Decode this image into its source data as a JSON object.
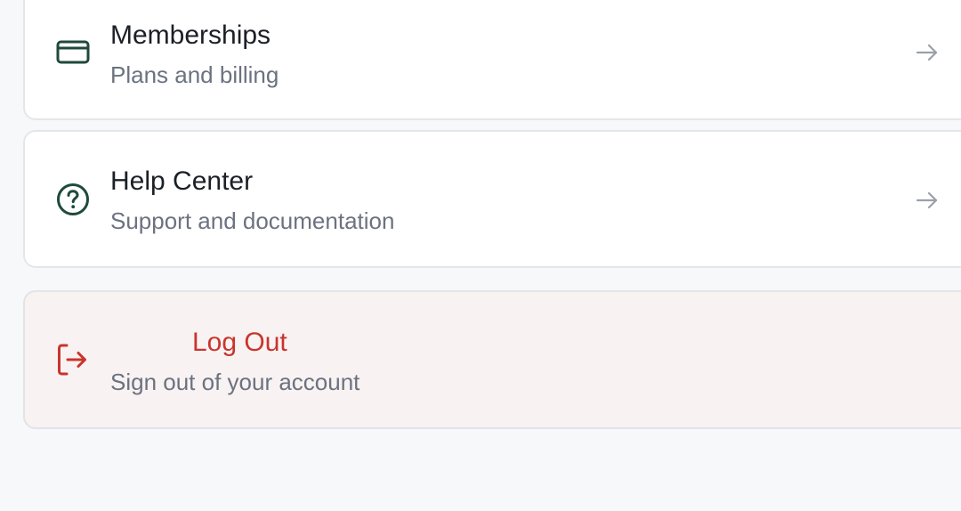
{
  "menu": {
    "memberships": {
      "icon": "credit-card-icon",
      "title": "Memberships",
      "subtitle": "Plans and billing",
      "arrow_icon": "arrow-right-icon"
    },
    "help_center": {
      "icon": "question-circle-icon",
      "title": "Help Center",
      "subtitle": "Support and documentation",
      "arrow_icon": "arrow-right-icon"
    },
    "log_out": {
      "icon": "log-out-icon",
      "title": "Log Out",
      "subtitle": "Sign out of your account"
    }
  },
  "colors": {
    "icon_green": "#1f4a3a",
    "danger_red": "#c9342d",
    "arrow_gray": "#9aa0a8",
    "page_background": "#f7f8fa",
    "logout_background": "#f8f2f2"
  }
}
